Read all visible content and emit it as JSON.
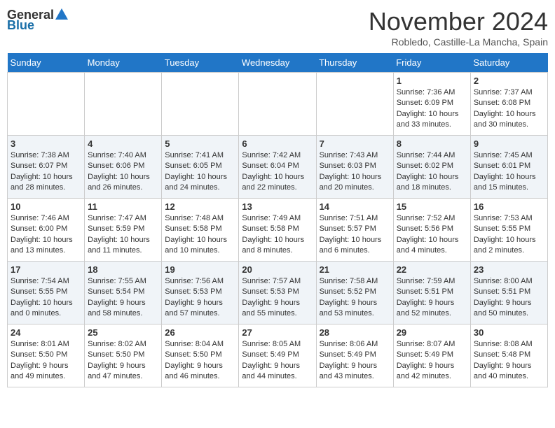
{
  "logo": {
    "general": "General",
    "blue": "Blue"
  },
  "title": "November 2024",
  "location": "Robledo, Castille-La Mancha, Spain",
  "days_header": [
    "Sunday",
    "Monday",
    "Tuesday",
    "Wednesday",
    "Thursday",
    "Friday",
    "Saturday"
  ],
  "weeks": [
    [
      {
        "day": "",
        "info": ""
      },
      {
        "day": "",
        "info": ""
      },
      {
        "day": "",
        "info": ""
      },
      {
        "day": "",
        "info": ""
      },
      {
        "day": "",
        "info": ""
      },
      {
        "day": "1",
        "info": "Sunrise: 7:36 AM\nSunset: 6:09 PM\nDaylight: 10 hours and 33 minutes."
      },
      {
        "day": "2",
        "info": "Sunrise: 7:37 AM\nSunset: 6:08 PM\nDaylight: 10 hours and 30 minutes."
      }
    ],
    [
      {
        "day": "3",
        "info": "Sunrise: 7:38 AM\nSunset: 6:07 PM\nDaylight: 10 hours and 28 minutes."
      },
      {
        "day": "4",
        "info": "Sunrise: 7:40 AM\nSunset: 6:06 PM\nDaylight: 10 hours and 26 minutes."
      },
      {
        "day": "5",
        "info": "Sunrise: 7:41 AM\nSunset: 6:05 PM\nDaylight: 10 hours and 24 minutes."
      },
      {
        "day": "6",
        "info": "Sunrise: 7:42 AM\nSunset: 6:04 PM\nDaylight: 10 hours and 22 minutes."
      },
      {
        "day": "7",
        "info": "Sunrise: 7:43 AM\nSunset: 6:03 PM\nDaylight: 10 hours and 20 minutes."
      },
      {
        "day": "8",
        "info": "Sunrise: 7:44 AM\nSunset: 6:02 PM\nDaylight: 10 hours and 18 minutes."
      },
      {
        "day": "9",
        "info": "Sunrise: 7:45 AM\nSunset: 6:01 PM\nDaylight: 10 hours and 15 minutes."
      }
    ],
    [
      {
        "day": "10",
        "info": "Sunrise: 7:46 AM\nSunset: 6:00 PM\nDaylight: 10 hours and 13 minutes."
      },
      {
        "day": "11",
        "info": "Sunrise: 7:47 AM\nSunset: 5:59 PM\nDaylight: 10 hours and 11 minutes."
      },
      {
        "day": "12",
        "info": "Sunrise: 7:48 AM\nSunset: 5:58 PM\nDaylight: 10 hours and 10 minutes."
      },
      {
        "day": "13",
        "info": "Sunrise: 7:49 AM\nSunset: 5:58 PM\nDaylight: 10 hours and 8 minutes."
      },
      {
        "day": "14",
        "info": "Sunrise: 7:51 AM\nSunset: 5:57 PM\nDaylight: 10 hours and 6 minutes."
      },
      {
        "day": "15",
        "info": "Sunrise: 7:52 AM\nSunset: 5:56 PM\nDaylight: 10 hours and 4 minutes."
      },
      {
        "day": "16",
        "info": "Sunrise: 7:53 AM\nSunset: 5:55 PM\nDaylight: 10 hours and 2 minutes."
      }
    ],
    [
      {
        "day": "17",
        "info": "Sunrise: 7:54 AM\nSunset: 5:55 PM\nDaylight: 10 hours and 0 minutes."
      },
      {
        "day": "18",
        "info": "Sunrise: 7:55 AM\nSunset: 5:54 PM\nDaylight: 9 hours and 58 minutes."
      },
      {
        "day": "19",
        "info": "Sunrise: 7:56 AM\nSunset: 5:53 PM\nDaylight: 9 hours and 57 minutes."
      },
      {
        "day": "20",
        "info": "Sunrise: 7:57 AM\nSunset: 5:53 PM\nDaylight: 9 hours and 55 minutes."
      },
      {
        "day": "21",
        "info": "Sunrise: 7:58 AM\nSunset: 5:52 PM\nDaylight: 9 hours and 53 minutes."
      },
      {
        "day": "22",
        "info": "Sunrise: 7:59 AM\nSunset: 5:51 PM\nDaylight: 9 hours and 52 minutes."
      },
      {
        "day": "23",
        "info": "Sunrise: 8:00 AM\nSunset: 5:51 PM\nDaylight: 9 hours and 50 minutes."
      }
    ],
    [
      {
        "day": "24",
        "info": "Sunrise: 8:01 AM\nSunset: 5:50 PM\nDaylight: 9 hours and 49 minutes."
      },
      {
        "day": "25",
        "info": "Sunrise: 8:02 AM\nSunset: 5:50 PM\nDaylight: 9 hours and 47 minutes."
      },
      {
        "day": "26",
        "info": "Sunrise: 8:04 AM\nSunset: 5:50 PM\nDaylight: 9 hours and 46 minutes."
      },
      {
        "day": "27",
        "info": "Sunrise: 8:05 AM\nSunset: 5:49 PM\nDaylight: 9 hours and 44 minutes."
      },
      {
        "day": "28",
        "info": "Sunrise: 8:06 AM\nSunset: 5:49 PM\nDaylight: 9 hours and 43 minutes."
      },
      {
        "day": "29",
        "info": "Sunrise: 8:07 AM\nSunset: 5:49 PM\nDaylight: 9 hours and 42 minutes."
      },
      {
        "day": "30",
        "info": "Sunrise: 8:08 AM\nSunset: 5:48 PM\nDaylight: 9 hours and 40 minutes."
      }
    ]
  ]
}
